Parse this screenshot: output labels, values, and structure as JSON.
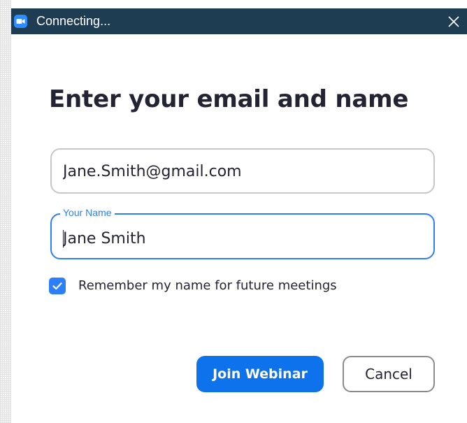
{
  "window": {
    "title": "Connecting...",
    "icon": "zoom-camera-icon",
    "close_icon": "close-icon",
    "titlebar_color": "#1f3d52"
  },
  "form": {
    "heading": "Enter your email and name",
    "email": {
      "value": "Jane.Smith@gmail.com",
      "placeholder": ""
    },
    "name": {
      "label": "Your Name",
      "value": "Jane Smith"
    },
    "remember": {
      "checked": true,
      "label": "Remember my name for future meetings"
    }
  },
  "actions": {
    "join_label": "Join Webinar",
    "cancel_label": "Cancel"
  },
  "colors": {
    "accent": "#2d7ff9",
    "primary_button": "#0e72ed",
    "text": "#232333"
  }
}
